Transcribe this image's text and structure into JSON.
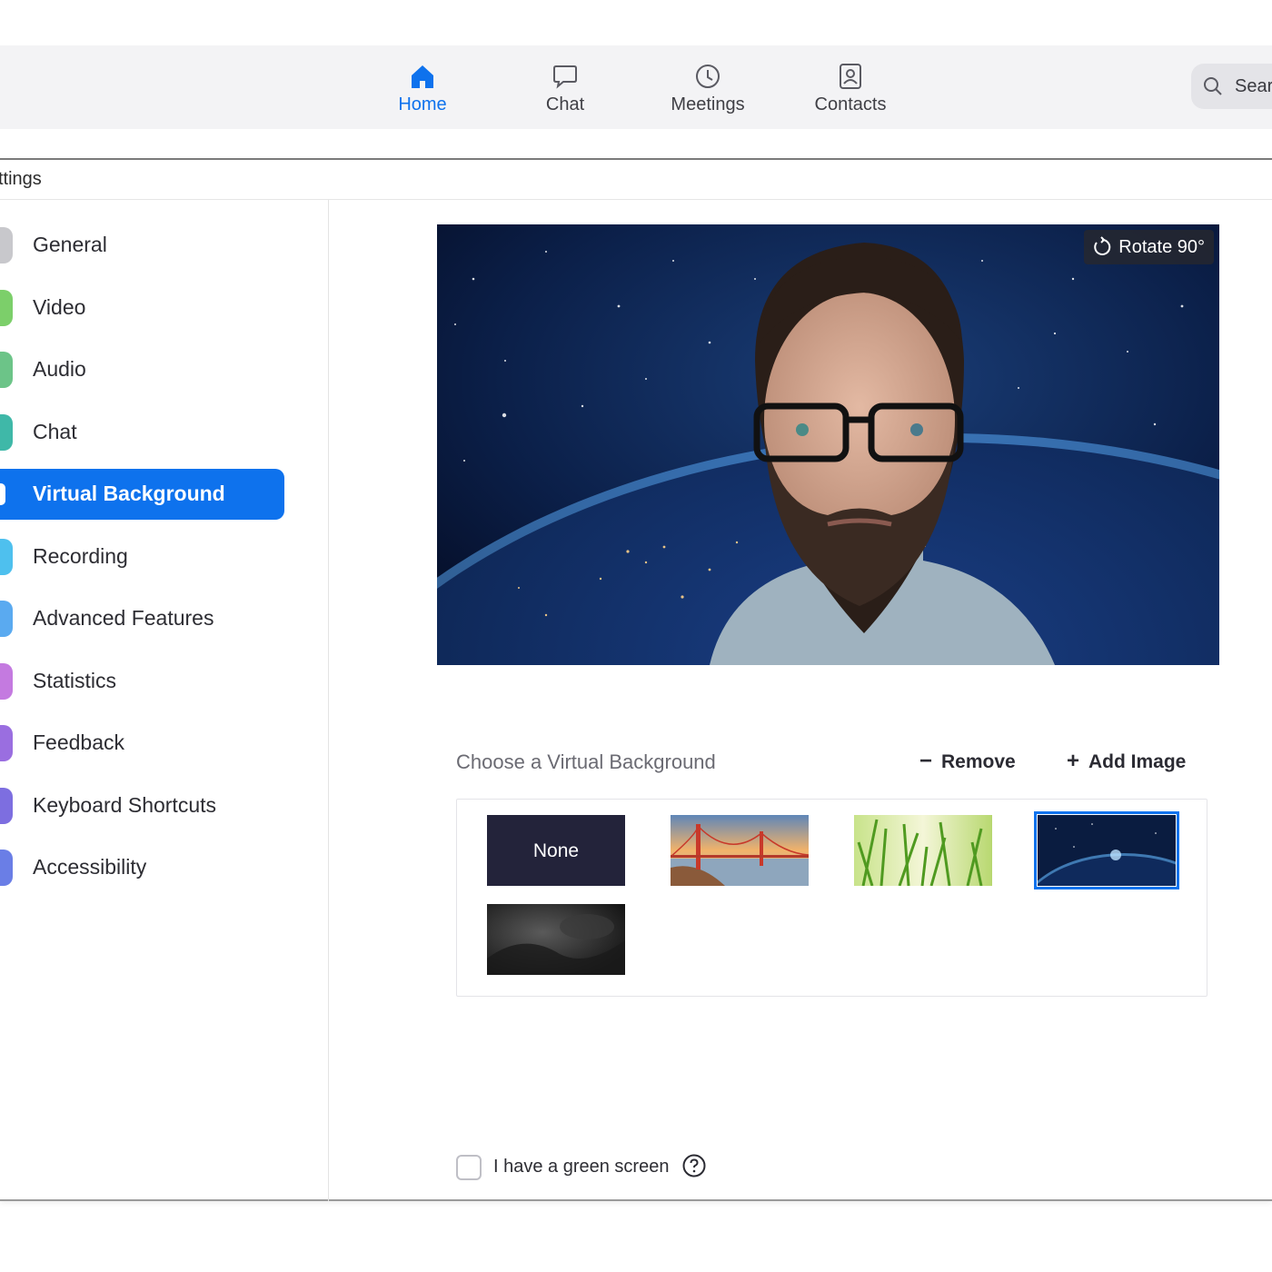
{
  "topnav": {
    "tabs": [
      {
        "label": "Home",
        "icon": "home-icon",
        "active": true
      },
      {
        "label": "Chat",
        "icon": "chat-bubble-icon",
        "active": false
      },
      {
        "label": "Meetings",
        "icon": "clock-icon",
        "active": false
      },
      {
        "label": "Contacts",
        "icon": "contacts-icon",
        "active": false
      }
    ],
    "search_label": "Sear",
    "accent_color": "#0e72ed"
  },
  "window": {
    "title": "ttings"
  },
  "sidebar": {
    "items": [
      {
        "label": "General",
        "icon_color": "#c8c8cc"
      },
      {
        "label": "Video",
        "icon_color": "#7ccf6a"
      },
      {
        "label": "Audio",
        "icon_color": "#6cc488"
      },
      {
        "label": "Chat",
        "icon_color": "#3fb8a8"
      },
      {
        "label": "Virtual Background",
        "icon_color": "#ffffff",
        "active": true
      },
      {
        "label": "Recording",
        "icon_color": "#4ec0ee"
      },
      {
        "label": "Advanced Features",
        "icon_color": "#5aaaf0"
      },
      {
        "label": "Statistics",
        "icon_color": "#c47ae0"
      },
      {
        "label": "Feedback",
        "icon_color": "#9a6ee0"
      },
      {
        "label": "Keyboard Shortcuts",
        "icon_color": "#7d6ee0"
      },
      {
        "label": "Accessibility",
        "icon_color": "#6a7ee6"
      }
    ]
  },
  "preview": {
    "rotate_label": "Rotate 90°"
  },
  "choose": {
    "title": "Choose a Virtual Background",
    "remove_icon": "−",
    "remove_label": "Remove",
    "add_icon": "+",
    "add_label": "Add Image",
    "thumbnails": [
      {
        "label": "None",
        "type": "none"
      },
      {
        "type": "golden-gate-bridge"
      },
      {
        "type": "grass"
      },
      {
        "type": "earth-from-space",
        "selected": true
      },
      {
        "type": "dark-texture"
      }
    ]
  },
  "green_screen": {
    "label": "I have a green screen",
    "checked": false
  }
}
